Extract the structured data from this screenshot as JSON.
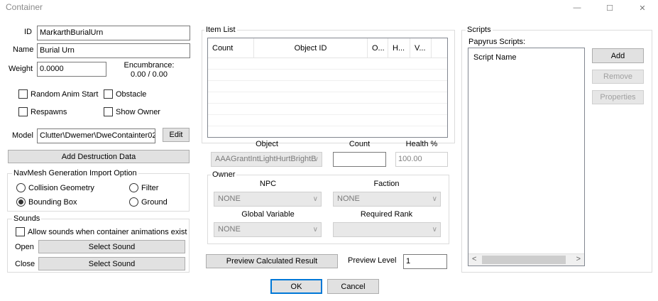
{
  "window": {
    "title": "Container",
    "minimize": "—",
    "maximize": "☐",
    "close": "✕"
  },
  "fields": {
    "id_label": "ID",
    "id_value": "MarkarthBurialUrn",
    "name_label": "Name",
    "name_value": "Burial Urn",
    "weight_label": "Weight",
    "weight_value": "0.0000",
    "encumbrance_label": "Encumbrance:",
    "encumbrance_value": "0.00 / 0.00"
  },
  "flags": {
    "random_anim_start": "Random Anim Start",
    "obstacle": "Obstacle",
    "respawns": "Respawns",
    "show_owner": "Show Owner"
  },
  "model": {
    "label": "Model",
    "value": "Clutter\\Dwemer\\DweContainter02",
    "edit_button": "Edit"
  },
  "destruction_button": "Add Destruction Data",
  "navmesh": {
    "legend": "NavMesh Generation Import Option",
    "collision_geometry": "Collision Geometry",
    "filter": "Filter",
    "bounding_box": "Bounding Box",
    "ground": "Ground",
    "selected": "bounding_box"
  },
  "sounds": {
    "legend": "Sounds",
    "allow_label": "Allow sounds when container animations exist",
    "open_label": "Open",
    "close_label": "Close",
    "select_sound": "Select Sound"
  },
  "item_list": {
    "legend": "Item List",
    "columns": [
      "Count",
      "Object ID",
      "O...",
      "H...",
      "V..."
    ],
    "object_label": "Object",
    "object_value": "AAAGrantIntLightHurtBrightB",
    "count_label": "Count",
    "count_value": "",
    "health_label": "Health %",
    "health_value": "100.00"
  },
  "owner": {
    "legend": "Owner",
    "npc_label": "NPC",
    "npc_value": "NONE",
    "faction_label": "Faction",
    "faction_value": "NONE",
    "global_label": "Global Variable",
    "global_value": "NONE",
    "rank_label": "Required Rank",
    "rank_value": ""
  },
  "preview": {
    "button": "Preview Calculated Result",
    "level_label": "Preview Level",
    "level_value": "1"
  },
  "scripts": {
    "legend": "Scripts",
    "papyrus_label": "Papyrus Scripts:",
    "column": "Script Name",
    "add": "Add",
    "remove": "Remove",
    "properties": "Properties",
    "scroll_left": "<",
    "scroll_right": ">"
  },
  "footer": {
    "ok": "OK",
    "cancel": "Cancel"
  }
}
